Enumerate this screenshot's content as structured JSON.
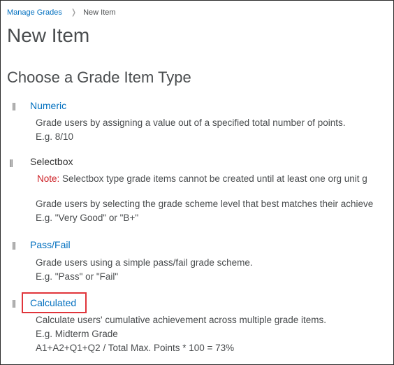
{
  "breadcrumb": {
    "parent": "Manage Grades",
    "current": "New Item"
  },
  "page_title": "New Item",
  "section_title": "Choose a Grade Item Type",
  "grade_types": {
    "numeric": {
      "label": "Numeric",
      "description": "Grade users by assigning a value out of a specified total number of points.",
      "example": "E.g. 8/10"
    },
    "selectbox": {
      "label": "Selectbox",
      "note_label": "Note:",
      "note_text": "Selectbox type grade items cannot be created until at least one org unit g",
      "description": "Grade users by selecting the grade scheme level that best matches their achieve",
      "example": "E.g. \"Very Good\" or \"B+\""
    },
    "passfail": {
      "label": "Pass/Fail",
      "description": "Grade users using a simple pass/fail grade scheme.",
      "example": "E.g. \"Pass\" or \"Fail\""
    },
    "calculated": {
      "label": "Calculated",
      "description": "Calculate users' cumulative achievement across multiple grade items.",
      "example": "E.g. Midterm Grade",
      "formula": "A1+A2+Q1+Q2 / Total Max. Points * 100 = 73%"
    }
  },
  "colors": {
    "link": "#006fbf",
    "note": "#cd2026",
    "highlight": "#e0353b",
    "heading": "#494c4e"
  },
  "icons": {
    "breadcrumb_separator": "chevron-right-icon",
    "type_marker": "radio-marker-icon"
  }
}
